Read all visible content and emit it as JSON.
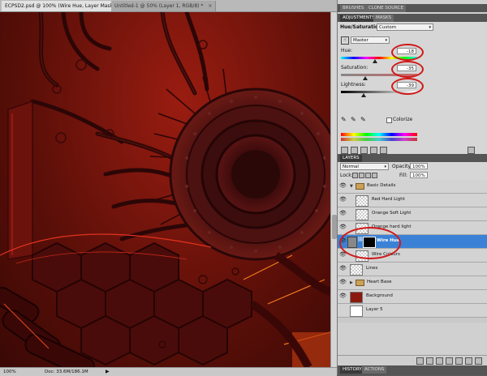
{
  "tabs": [
    {
      "label": "ECPSD2.psd @ 100% (Wire Hue, Layer Mask/8) *",
      "state": "active"
    },
    {
      "label": "Untitled-1 @ 50% (Layer 1, RGB/8) *",
      "state": "inactive"
    }
  ],
  "status": {
    "zoom": "100%",
    "doc": "Doc: 33.6M/186.1M"
  },
  "panel_top": {
    "tabs": [
      "BRUSHES",
      "CLONE SOURCE"
    ]
  },
  "adjustments": {
    "tabs": [
      "ADJUSTMENTS",
      "MASKS"
    ],
    "title": "Hue/Saturation",
    "preset": "Custom",
    "edit": "Master",
    "hue_label": "Hue:",
    "hue_value": "-18",
    "saturation_label": "Saturation:",
    "saturation_value": "-35",
    "lightness_label": "Lightness:",
    "lightness_value": "-39",
    "colorize_label": "Colorize",
    "hue_pos": 0.45,
    "saturation_pos": 0.32,
    "lightness_pos": 0.3
  },
  "layers": {
    "tabs": [
      "LAYERS",
      "CHANNELS",
      "PATHS"
    ],
    "blend_mode": "Normal",
    "opacity_label": "Opacity:",
    "opacity_value": "100%",
    "lock_label": "Lock:",
    "fill_label": "Fill:",
    "fill_value": "100%",
    "rows": [
      {
        "name": "Basic Details",
        "kind": "group",
        "selected": false
      },
      {
        "name": "Red Hard Light",
        "kind": "layer",
        "selected": false
      },
      {
        "name": "Orange Soft Light",
        "kind": "layer",
        "selected": false
      },
      {
        "name": "Orange hard light",
        "kind": "layer",
        "selected": false
      },
      {
        "name": "Wire Hue",
        "kind": "adjustment",
        "selected": true
      },
      {
        "name": "Wire Colours",
        "kind": "layer",
        "selected": false
      },
      {
        "name": "Lines",
        "kind": "layer",
        "selected": false
      },
      {
        "name": "Heart Base",
        "kind": "group",
        "selected": false
      },
      {
        "name": "Background",
        "kind": "layer",
        "selected": false
      },
      {
        "name": "Layer 5",
        "kind": "layer",
        "selected": false
      }
    ]
  },
  "bottom_tabs": [
    "HISTORY",
    "ACTIONS"
  ],
  "colors": {
    "selection": "#3b82d6",
    "annotation": "#d01818",
    "canvas_red": "#7a160d"
  },
  "icons": [
    "eye-icon",
    "folder-icon",
    "link-icon",
    "fx-icon",
    "mask-icon",
    "new-layer-icon",
    "trash-icon"
  ]
}
